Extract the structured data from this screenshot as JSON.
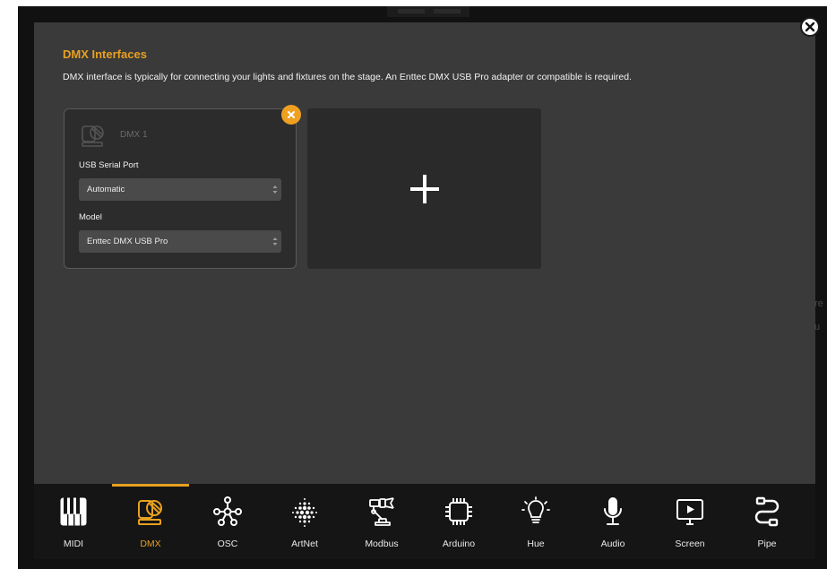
{
  "header": {
    "title": "DMX Interfaces",
    "description": "DMX interface is typically for connecting your lights and fixtures on the stage. An Enttec DMX USB Pro adapter or compatible is required."
  },
  "interfaces": [
    {
      "name": "DMX 1",
      "port_label": "USB Serial Port",
      "port_value": "Automatic",
      "model_label": "Model",
      "model_value": "Enttec DMX USB Pro"
    }
  ],
  "add_card": {
    "icon": "plus-icon"
  },
  "tabs": [
    {
      "label": "MIDI",
      "icon": "piano-keys-icon"
    },
    {
      "label": "DMX",
      "icon": "moving-head-light-icon",
      "active": true
    },
    {
      "label": "OSC",
      "icon": "network-nodes-icon"
    },
    {
      "label": "ArtNet",
      "icon": "dot-matrix-icon"
    },
    {
      "label": "Modbus",
      "icon": "robot-arm-icon"
    },
    {
      "label": "Arduino",
      "icon": "chip-icon"
    },
    {
      "label": "Hue",
      "icon": "light-bulb-icon"
    },
    {
      "label": "Audio",
      "icon": "microphone-icon"
    },
    {
      "label": "Screen",
      "icon": "screen-play-icon"
    },
    {
      "label": "Pipe",
      "icon": "pipe-icon"
    }
  ],
  "colors": {
    "accent": "#e8a020",
    "panel": "#3a3a3a",
    "card": "#2c2c2c",
    "tabbar": "#151515"
  }
}
